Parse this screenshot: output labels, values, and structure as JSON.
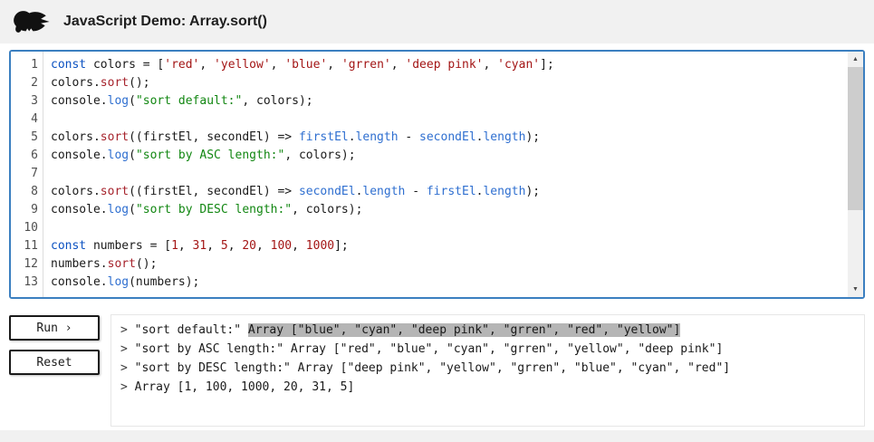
{
  "header": {
    "title": "JavaScript Demo: Array.sort()"
  },
  "editor": {
    "lines": [
      {
        "n": 1,
        "tokens": [
          [
            "const ",
            "kw"
          ],
          [
            "colors = [",
            "pl"
          ],
          [
            "'red'",
            "str"
          ],
          [
            ", ",
            "pl"
          ],
          [
            "'yellow'",
            "str"
          ],
          [
            ", ",
            "pl"
          ],
          [
            "'blue'",
            "str"
          ],
          [
            ", ",
            "pl"
          ],
          [
            "'grren'",
            "str"
          ],
          [
            ", ",
            "pl"
          ],
          [
            "'deep pink'",
            "str"
          ],
          [
            ", ",
            "pl"
          ],
          [
            "'cyan'",
            "str"
          ],
          [
            "];",
            "pl"
          ]
        ]
      },
      {
        "n": 2,
        "tokens": [
          [
            "colors.",
            "pl"
          ],
          [
            "sort",
            "meth"
          ],
          [
            "();",
            "pl"
          ]
        ]
      },
      {
        "n": 3,
        "tokens": [
          [
            "console.",
            "pl"
          ],
          [
            "log",
            "fn"
          ],
          [
            "(",
            "pl"
          ],
          [
            "\"sort default:\"",
            "gstr"
          ],
          [
            ", colors);",
            "pl"
          ]
        ]
      },
      {
        "n": 4,
        "tokens": []
      },
      {
        "n": 5,
        "tokens": [
          [
            "colors.",
            "pl"
          ],
          [
            "sort",
            "meth"
          ],
          [
            "((firstEl, secondEl) => ",
            "pl"
          ],
          [
            "firstEl",
            "blue"
          ],
          [
            ".",
            "pl"
          ],
          [
            "length",
            "blue"
          ],
          [
            " - ",
            "pl"
          ],
          [
            "secondEl",
            "blue"
          ],
          [
            ".",
            "pl"
          ],
          [
            "length",
            "blue"
          ],
          [
            ");",
            "pl"
          ]
        ]
      },
      {
        "n": 6,
        "tokens": [
          [
            "console.",
            "pl"
          ],
          [
            "log",
            "fn"
          ],
          [
            "(",
            "pl"
          ],
          [
            "\"sort by ASC length:\"",
            "gstr"
          ],
          [
            ", colors);",
            "pl"
          ]
        ]
      },
      {
        "n": 7,
        "tokens": []
      },
      {
        "n": 8,
        "tokens": [
          [
            "colors.",
            "pl"
          ],
          [
            "sort",
            "meth"
          ],
          [
            "((firstEl, secondEl) => ",
            "pl"
          ],
          [
            "secondEl",
            "blue"
          ],
          [
            ".",
            "pl"
          ],
          [
            "length",
            "blue"
          ],
          [
            " - ",
            "pl"
          ],
          [
            "firstEl",
            "blue"
          ],
          [
            ".",
            "pl"
          ],
          [
            "length",
            "blue"
          ],
          [
            ");",
            "pl"
          ]
        ]
      },
      {
        "n": 9,
        "tokens": [
          [
            "console.",
            "pl"
          ],
          [
            "log",
            "fn"
          ],
          [
            "(",
            "pl"
          ],
          [
            "\"sort by DESC length:\"",
            "gstr"
          ],
          [
            ", colors);",
            "pl"
          ]
        ]
      },
      {
        "n": 10,
        "tokens": []
      },
      {
        "n": 11,
        "tokens": [
          [
            "const ",
            "kw"
          ],
          [
            "numbers = [",
            "pl"
          ],
          [
            "1",
            "num"
          ],
          [
            ", ",
            "pl"
          ],
          [
            "31",
            "num"
          ],
          [
            ", ",
            "pl"
          ],
          [
            "5",
            "num"
          ],
          [
            ", ",
            "pl"
          ],
          [
            "20",
            "num"
          ],
          [
            ", ",
            "pl"
          ],
          [
            "100",
            "num"
          ],
          [
            ", ",
            "pl"
          ],
          [
            "1000",
            "num"
          ],
          [
            "];",
            "pl"
          ]
        ]
      },
      {
        "n": 12,
        "tokens": [
          [
            "numbers.",
            "pl"
          ],
          [
            "sort",
            "meth"
          ],
          [
            "();",
            "pl"
          ]
        ]
      },
      {
        "n": 13,
        "tokens": [
          [
            "console.",
            "pl"
          ],
          [
            "log",
            "fn"
          ],
          [
            "(numbers);",
            "pl"
          ]
        ]
      }
    ]
  },
  "controls": {
    "run_label": "Run ›",
    "reset_label": "Reset"
  },
  "console": {
    "prompt": ">",
    "lines": [
      {
        "segments": [
          {
            "text": "\"sort default:\" ",
            "hl": false
          },
          {
            "text": "Array [\"blue\", \"cyan\", \"deep pink\", \"grren\", \"red\", \"yellow\"]",
            "hl": true
          }
        ]
      },
      {
        "segments": [
          {
            "text": "\"sort by ASC length:\" Array [\"red\", \"blue\", \"cyan\", \"grren\", \"yellow\", \"deep pink\"]",
            "hl": false
          }
        ]
      },
      {
        "segments": [
          {
            "text": "\"sort by DESC length:\" Array [\"deep pink\", \"yellow\", \"grren\", \"blue\", \"cyan\", \"red\"]",
            "hl": false
          }
        ]
      },
      {
        "segments": [
          {
            "text": "Array [1, 100, 1000, 20, 31, 5]",
            "hl": false
          }
        ]
      }
    ]
  },
  "colors": {
    "editor_border": "#3b7fc0",
    "header_background": "#f1f1f1",
    "selection_highlight": "#b5b5b5",
    "keyword": "#0b51c1",
    "string_single": "#a31515",
    "string_double": "#128712",
    "method": "#a6232c",
    "builtin": "#2f6fd0"
  }
}
